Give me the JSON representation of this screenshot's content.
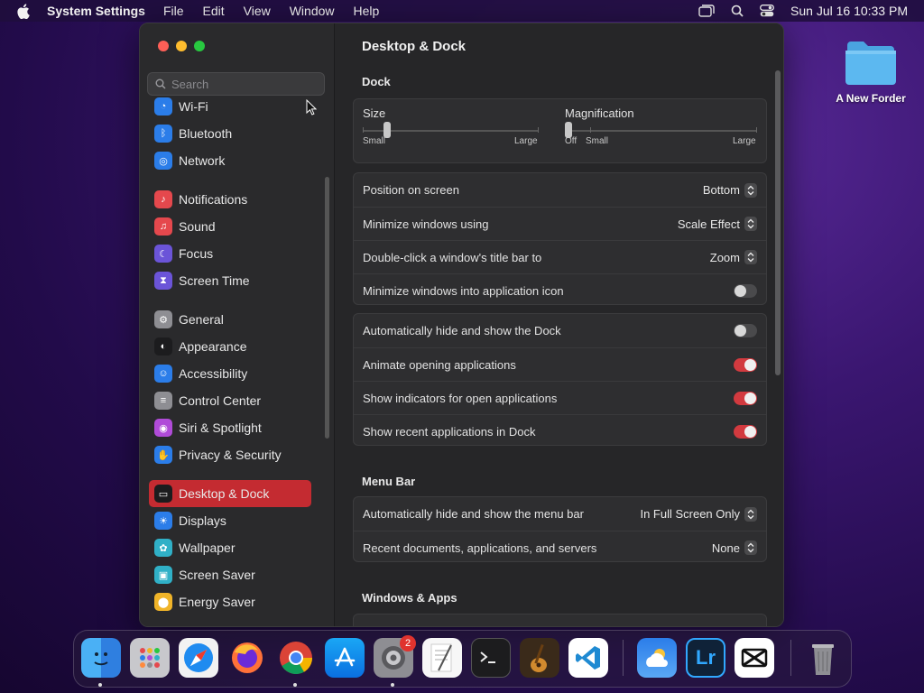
{
  "menubar": {
    "app_name": "System Settings",
    "items": [
      "File",
      "Edit",
      "View",
      "Window",
      "Help"
    ],
    "clock": "Sun Jul 16  10:33 PM"
  },
  "desktop": {
    "folder_label": "A New Forder"
  },
  "sidebar": {
    "search_placeholder": "Search",
    "items": [
      {
        "label": "Wi-Fi",
        "icon": "wifi-icon",
        "color": "#2b7de9"
      },
      {
        "label": "Bluetooth",
        "icon": "bluetooth-icon",
        "color": "#2b7de9"
      },
      {
        "label": "Network",
        "icon": "globe-icon",
        "color": "#2b7de9"
      },
      {
        "label": "Notifications",
        "icon": "bell-icon",
        "color": "#e5484d"
      },
      {
        "label": "Sound",
        "icon": "speaker-icon",
        "color": "#e5484d"
      },
      {
        "label": "Focus",
        "icon": "moon-icon",
        "color": "#6b54d8"
      },
      {
        "label": "Screen Time",
        "icon": "hourglass-icon",
        "color": "#6b54d8"
      },
      {
        "label": "General",
        "icon": "gear-icon",
        "color": "#8e8e93"
      },
      {
        "label": "Appearance",
        "icon": "appearance-icon",
        "color": "#1c1c1e"
      },
      {
        "label": "Accessibility",
        "icon": "accessibility-icon",
        "color": "#2b7de9"
      },
      {
        "label": "Control Center",
        "icon": "control-center-icon",
        "color": "#8e8e93"
      },
      {
        "label": "Siri & Spotlight",
        "icon": "siri-icon",
        "color": "#b04bd8"
      },
      {
        "label": "Privacy & Security",
        "icon": "hand-icon",
        "color": "#2b7de9"
      },
      {
        "label": "Desktop & Dock",
        "icon": "dock-icon",
        "color": "#1c1c1e"
      },
      {
        "label": "Displays",
        "icon": "sun-icon",
        "color": "#2b7de9"
      },
      {
        "label": "Wallpaper",
        "icon": "flower-icon",
        "color": "#30b0c7"
      },
      {
        "label": "Screen Saver",
        "icon": "screen-saver-icon",
        "color": "#30b0c7"
      },
      {
        "label": "Energy Saver",
        "icon": "bulb-icon",
        "color": "#f0b429"
      }
    ]
  },
  "content": {
    "title": "Desktop & Dock",
    "dock_section": "Dock",
    "size_label": "Size",
    "size_small": "Small",
    "size_large": "Large",
    "size_value_pct": 14,
    "mag_label": "Magnification",
    "mag_off": "Off",
    "mag_small": "Small",
    "mag_large": "Large",
    "mag_value_pct": 0,
    "group1": [
      {
        "label": "Position on screen",
        "value": "Bottom"
      },
      {
        "label": "Minimize windows using",
        "value": "Scale Effect"
      },
      {
        "label": "Double-click a window's title bar to",
        "value": "Zoom"
      },
      {
        "label": "Minimize windows into application icon",
        "toggle": false
      }
    ],
    "group2": [
      {
        "label": "Automatically hide and show the Dock",
        "toggle": false
      },
      {
        "label": "Animate opening applications",
        "toggle": true
      },
      {
        "label": "Show indicators for open applications",
        "toggle": true
      },
      {
        "label": "Show recent applications in Dock",
        "toggle": true
      }
    ],
    "menubar_section": "Menu Bar",
    "group3": [
      {
        "label": "Automatically hide and show the menu bar",
        "value": "In Full Screen Only"
      },
      {
        "label": "Recent documents, applications, and servers",
        "value": "None"
      }
    ],
    "windows_section": "Windows & Apps"
  },
  "dock": {
    "settings_badge": "2",
    "lightroom_label": "Lr",
    "apps": [
      "finder-icon",
      "launchpad-icon",
      "safari-icon",
      "firefox-icon",
      "chrome-icon",
      "app-store-icon",
      "system-settings-icon",
      "textedit-icon",
      "terminal-icon",
      "garageband-icon",
      "vscode-icon",
      "weather-icon",
      "lightroom-icon",
      "capcut-icon",
      "trash-icon"
    ]
  }
}
